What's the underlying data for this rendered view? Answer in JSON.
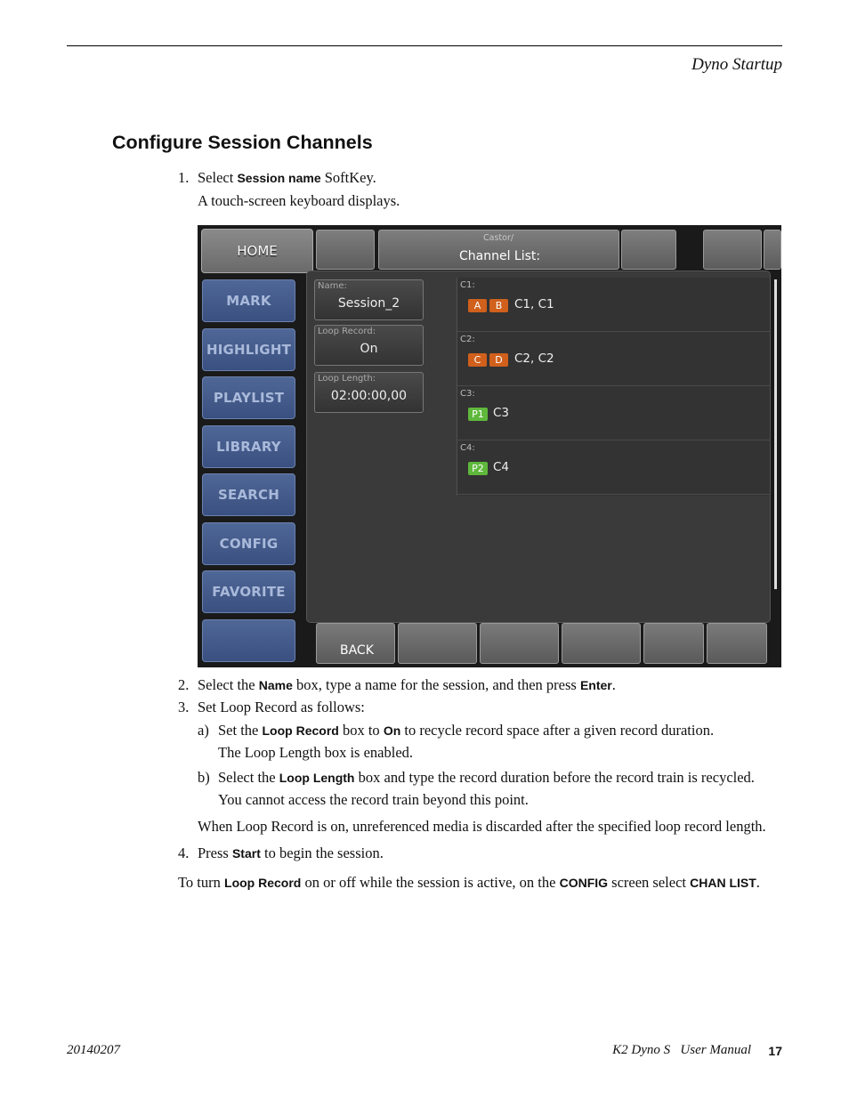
{
  "header": {
    "section": "Dyno Startup"
  },
  "heading": "Configure Session Channels",
  "steps": {
    "s1_num": "1.",
    "s1_a": "Select ",
    "s1_b": "Session name",
    "s1_c": " SoftKey.",
    "s1_sub": "A touch-screen keyboard displays.",
    "s2_num": "2.",
    "s2_a": "Select the ",
    "s2_b": "Name",
    "s2_c": " box, type a name for the session, and then press ",
    "s2_d": "Enter",
    "s2_e": ".",
    "s3_num": "3.",
    "s3_text": "Set Loop Record as follows:",
    "a_num": "a)",
    "a_a": "Set the ",
    "a_b": "Loop Record",
    "a_c": " box to ",
    "a_d": "On",
    "a_e": " to recycle record space after a given record duration.",
    "a_sub": "The Loop Length box is enabled.",
    "b_num": "b)",
    "b_a": "Select the ",
    "b_b": "Loop Length",
    "b_c": " box and type the record duration before the record train is recycled.",
    "b_sub": "You cannot access the record train beyond this point.",
    "note": "When Loop Record is on, unreferenced media is discarded after the specified loop record length.",
    "s4_num": "4.",
    "s4_a": "Press ",
    "s4_b": "Start",
    "s4_c": " to begin the session.",
    "tail_a": "To turn ",
    "tail_b": "Loop Record",
    "tail_c": " on or off while the session is active, on the ",
    "tail_d": "CONFIG",
    "tail_e": " screen select ",
    "tail_f": "CHAN LIST",
    "tail_g": "."
  },
  "screen": {
    "home": "HOME",
    "path_small": "Castor/",
    "path_title": "Channel List:",
    "side_buttons": [
      "MARK",
      "HIGHLIGHT",
      "PLAYLIST",
      "LIBRARY",
      "SEARCH",
      "CONFIG",
      "FAVORITE"
    ],
    "fields": {
      "name_label": "Name:",
      "name_value": "Session_2",
      "loop_label": "Loop Record:",
      "loop_value": "On",
      "length_label": "Loop Length:",
      "length_value": "02:00:00,00"
    },
    "channels": [
      {
        "label": "C1:",
        "badges": [
          "A",
          "B"
        ],
        "name": "C1, C1"
      },
      {
        "label": "C2:",
        "badges": [
          "C",
          "D"
        ],
        "name": "C2, C2"
      },
      {
        "label": "C3:",
        "badges": [
          "P1"
        ],
        "name": "C3"
      },
      {
        "label": "C4:",
        "badges": [
          "P2"
        ],
        "name": "C4"
      }
    ],
    "back": "BACK"
  },
  "footer": {
    "date": "20140207",
    "manual": "K2 Dyno S   User Manual",
    "page": "17"
  }
}
